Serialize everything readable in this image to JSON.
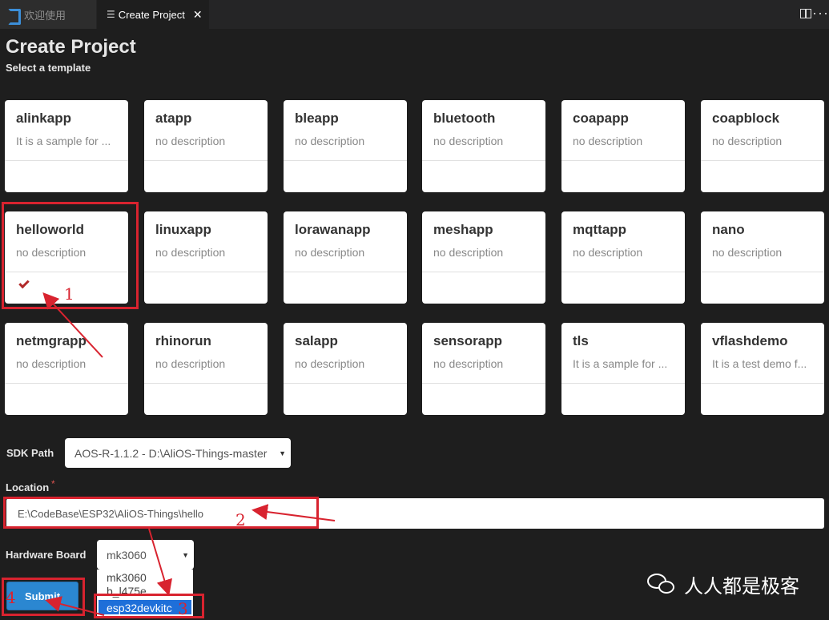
{
  "tabs": [
    {
      "label": "欢迎使用",
      "active": false
    },
    {
      "label": "Create Project",
      "active": true
    }
  ],
  "page": {
    "title": "Create Project",
    "subtitle": "Select a template"
  },
  "templates": [
    {
      "name": "alinkapp",
      "description": "It is a sample for ..."
    },
    {
      "name": "atapp",
      "description": "no description"
    },
    {
      "name": "bleapp",
      "description": "no description"
    },
    {
      "name": "bluetooth",
      "description": "no description"
    },
    {
      "name": "coapapp",
      "description": "no description"
    },
    {
      "name": "coapblock",
      "description": "no description"
    },
    {
      "name": "helloworld",
      "description": "no description",
      "selected": true
    },
    {
      "name": "linuxapp",
      "description": "no description"
    },
    {
      "name": "lorawanapp",
      "description": "no description"
    },
    {
      "name": "meshapp",
      "description": "no description"
    },
    {
      "name": "mqttapp",
      "description": "no description"
    },
    {
      "name": "nano",
      "description": "no description"
    },
    {
      "name": "netmgrapp",
      "description": "no description"
    },
    {
      "name": "rhinorun",
      "description": "no description"
    },
    {
      "name": "salapp",
      "description": "no description"
    },
    {
      "name": "sensorapp",
      "description": "no description"
    },
    {
      "name": "tls",
      "description": "It is a sample for ..."
    },
    {
      "name": "vflashdemo",
      "description": "It is a test demo f..."
    }
  ],
  "form": {
    "sdk_label": "SDK Path",
    "sdk_value": "AOS-R-1.1.2 - D:\\AliOS-Things-master",
    "location_label": "Location",
    "location_required": "*",
    "location_value": "E:\\CodeBase\\ESP32\\AliOS-Things\\hello",
    "board_label": "Hardware Board",
    "board_value": "mk3060",
    "board_options": [
      "mk3060",
      "b_l475e",
      "esp32devkitc"
    ],
    "board_highlighted": "esp32devkitc",
    "submit_label": "Submit"
  },
  "annotations": [
    "1",
    "2",
    "3",
    "4"
  ],
  "watermark": "人人都是极客",
  "colors": {
    "annotation": "#d8232f",
    "submit": "#2b87d1",
    "check": "#b22a2a",
    "highlight": "#1e6fd9"
  }
}
